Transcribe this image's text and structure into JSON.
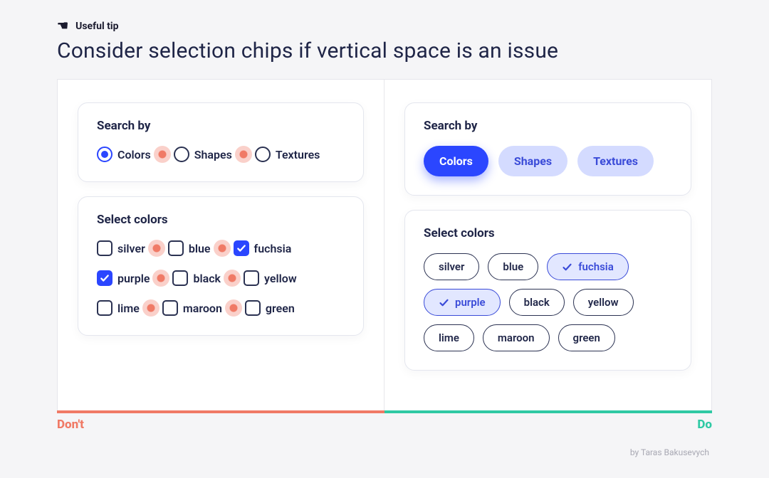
{
  "tip": {
    "badge": "Useful tip",
    "title": "Consider selection chips if vertical space is an issue"
  },
  "dont": {
    "section_label": "Don't",
    "search": {
      "title": "Search by",
      "options": [
        {
          "label": "Colors",
          "selected": true
        },
        {
          "label": "Shapes",
          "selected": false
        },
        {
          "label": "Textures",
          "selected": false
        }
      ]
    },
    "select": {
      "title": "Select colors",
      "rows": [
        [
          {
            "label": "silver",
            "checked": false
          },
          {
            "label": "blue",
            "checked": false
          },
          {
            "label": "fuchsia",
            "checked": true
          }
        ],
        [
          {
            "label": "purple",
            "checked": true
          },
          {
            "label": "black",
            "checked": false
          },
          {
            "label": "yellow",
            "checked": false
          }
        ],
        [
          {
            "label": "lime",
            "checked": false
          },
          {
            "label": "maroon",
            "checked": false
          },
          {
            "label": "green",
            "checked": false
          }
        ]
      ]
    }
  },
  "do": {
    "section_label": "Do",
    "search": {
      "title": "Search by",
      "options": [
        {
          "label": "Colors",
          "selected": true
        },
        {
          "label": "Shapes",
          "selected": false
        },
        {
          "label": "Textures",
          "selected": false
        }
      ]
    },
    "select": {
      "title": "Select colors",
      "chips": [
        {
          "label": "silver",
          "selected": false
        },
        {
          "label": "blue",
          "selected": false
        },
        {
          "label": "fuchsia",
          "selected": true
        },
        {
          "label": "purple",
          "selected": true
        },
        {
          "label": "black",
          "selected": false
        },
        {
          "label": "yellow",
          "selected": false
        },
        {
          "label": "lime",
          "selected": false
        },
        {
          "label": "maroon",
          "selected": false
        },
        {
          "label": "green",
          "selected": false
        }
      ]
    }
  },
  "credit": "by Taras Bakusevych",
  "colors": {
    "accent": "#2b46ff",
    "accent_light": "#d4dbff",
    "chip_selected_bg": "#e2e7ff",
    "dont": "#f07a66",
    "do": "#2fc9a4"
  }
}
